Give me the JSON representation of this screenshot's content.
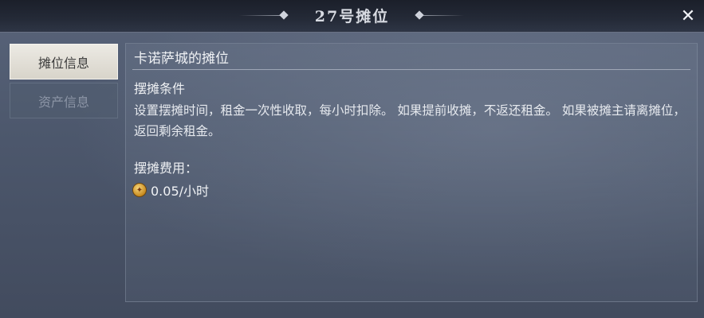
{
  "window": {
    "title": "27号摊位",
    "close_icon": "close-icon"
  },
  "sidebar": {
    "tabs": [
      {
        "label": "摊位信息",
        "active": true
      },
      {
        "label": "资产信息",
        "active": false
      }
    ]
  },
  "panel": {
    "title": "卡诺萨城的摊位",
    "section_heading": "摆摊条件",
    "description": "设置摆摊时间，租金一次性收取，每小时扣除。 如果提前收摊，不返还租金。 如果被摊主请离摊位，返回剩余租金。",
    "fee_heading": "摆摊费用：",
    "fee_icon": "gold-coin-icon",
    "fee_value": "0.05/小时"
  },
  "colors": {
    "active_tab_bg": "#e4e1d9",
    "inactive_tab_bg": "#505c70",
    "panel_text": "#e6e9ee",
    "coin": "#d9a23a"
  }
}
